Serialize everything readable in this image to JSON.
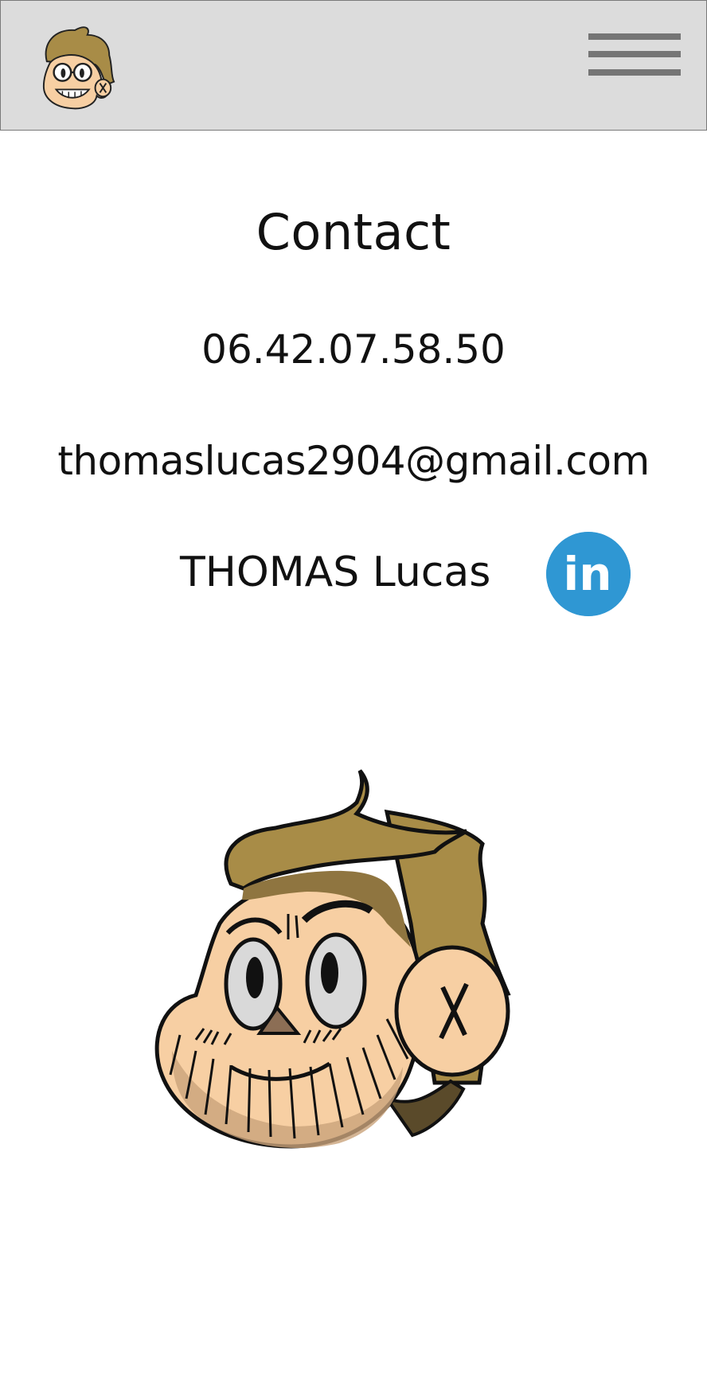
{
  "header": {
    "logo_icon": "cartoon-face-logo-icon",
    "menu_icon": "hamburger-menu-icon"
  },
  "contact": {
    "title": "Contact",
    "phone": "06.42.07.58.50",
    "email": "thomaslucas2904@gmail.com",
    "linkedin_name": "THOMAS Lucas",
    "linkedin_icon": "linkedin-icon",
    "linkedin_text": "in"
  },
  "illustration": {
    "icon": "cartoon-face-avatar-icon"
  },
  "colors": {
    "header_bg": "#dcdcdc",
    "menu_bars": "#757575",
    "linkedin_blue": "#2f97d3",
    "hair": "#a88c47",
    "skin": "#f7cfa3",
    "eye_white": "#d9d9d9"
  }
}
